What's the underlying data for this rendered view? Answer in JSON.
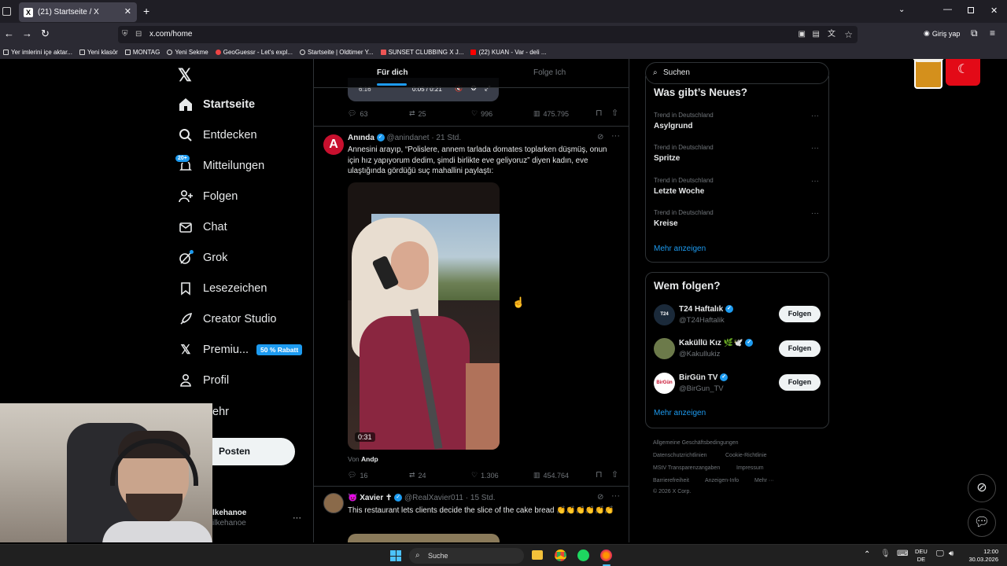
{
  "browser": {
    "tab_title": "(21) Startseite / X",
    "url": "x.com/home",
    "account_label": "Giriş yap",
    "bookmarks": [
      "Yer imlerini içe aktar...",
      "Yeni klasör",
      "MONTAG",
      "Yeni Sekme",
      "GeoGuessr - Let's expl...",
      "Startseite | Oldtimer Y...",
      "SUNSET CLUBBING X J...",
      "(22) KUAN - Var - deli ..."
    ]
  },
  "nav": {
    "home": "Startseite",
    "explore": "Entdecken",
    "notifications": "Mitteilungen",
    "notifications_badge": "20+",
    "follow": "Folgen",
    "chat": "Chat",
    "grok": "Grok",
    "bookmarks": "Lesezeichen",
    "creator_studio": "Creator Studio",
    "premium": "Premiu...",
    "premium_badge": "50 % Rabatt",
    "profile": "Profil",
    "more": "ehr",
    "post_button": "Posten",
    "user_name": "lkehanoe",
    "user_handle": "ilkehanoe"
  },
  "feed": {
    "tab_for_you": "Für dich",
    "tab_following": "Folge Ich",
    "prev_video_time1": "6:16",
    "prev_video_time2": "0:05 / 0:21",
    "prev_metrics": {
      "replies": "63",
      "reposts": "25",
      "likes": "996",
      "views": "475.795"
    },
    "tweet1": {
      "name": "Anında",
      "handle": "@anindanet",
      "time": "· 21 Std.",
      "text": "Annesini arayıp, “Polislere, annem tarlada domates toplarken düşmüş, onun için hız yapıyorum dedim, şimdi birlikte eve geliyoruz” diyen kadın, eve ulaştığında gördüğü suç mahallini paylaştı:",
      "video_duration": "0:31",
      "source_prefix": "Von",
      "source": "Andp",
      "replies": "16",
      "reposts": "24",
      "likes": "1.306",
      "views": "454.764"
    },
    "tweet2": {
      "name": "Xavier ✝",
      "handle": "@RealXavier011",
      "time": "· 15 Std.",
      "text": "This restaurant lets clients decide the slice of the cake bread 👏👏👏👏👏👏"
    }
  },
  "sidebar": {
    "search_placeholder": "Suchen",
    "trends_title": "Was gibt’s Neues?",
    "trends": [
      {
        "category": "Trend in Deutschland",
        "name": "Asylgrund"
      },
      {
        "category": "Trend in Deutschland",
        "name": "Spritze"
      },
      {
        "category": "Trend in Deutschland",
        "name": "Letzte Woche"
      },
      {
        "category": "Trend in Deutschland",
        "name": "Kreise"
      }
    ],
    "show_more": "Mehr anzeigen",
    "who_to_follow_title": "Wem folgen?",
    "who_to_follow": [
      {
        "name": "T24 Haftalık",
        "handle": "@T24Haftalik",
        "button": "Folgen"
      },
      {
        "name": "Kaküllü Kız 🌿🕊️",
        "handle": "@Kakullukiz",
        "button": "Folgen"
      },
      {
        "name": "BirGün TV",
        "handle": "@BirGun_TV",
        "button": "Folgen"
      }
    ],
    "show_more2": "Mehr anzeigen",
    "footer": [
      "Allgemeine Geschäftsbedingungen",
      "Datenschutzrichtlinien",
      "Cookie-Richtlinie",
      "MStV Transparenzangaben",
      "Impressum",
      "Barrierefreiheit",
      "Anzeigen-Info",
      "Mehr ···",
      "© 2026 X Corp."
    ]
  },
  "taskbar": {
    "search": "Suche",
    "lang_top": "DEU",
    "lang_bottom": "DE",
    "time": "12:00",
    "date": "30.03.2026"
  },
  "colors": {
    "accent": "#1d9bf0",
    "background": "#000000",
    "text": "#e7e9ea",
    "muted": "#71767b"
  }
}
